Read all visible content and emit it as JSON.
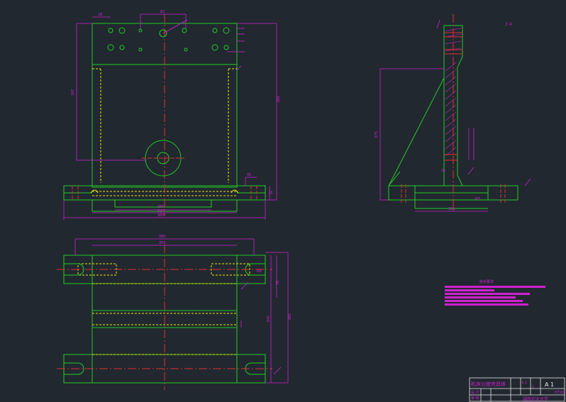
{
  "colors": {
    "background": "#212830",
    "outline": "#22cc22",
    "hidden": "#e8e800",
    "center": "#e03030",
    "dimension": "#d020d0",
    "bolt": "#e03030"
  },
  "front_view": {
    "dims": {
      "top_left": "26",
      "top_mid": "82",
      "overall_width": "380",
      "base_inner": "280",
      "base_mid": "320",
      "height_left": "347",
      "height_right": "388",
      "right_side": "45",
      "right_low": "36"
    }
  },
  "side_view": {
    "dims": {
      "height": "375",
      "base_width": "100",
      "fillet": "R5",
      "small": "2x"
    }
  },
  "plan_view": {
    "dims": {
      "overall_width": "380",
      "inner_width": "300",
      "h1": "78",
      "h2": "340",
      "h3": "380",
      "right_small": "R8"
    }
  },
  "top_right_note": "3 4",
  "notes_title": "技术要求",
  "title_block": {
    "title": "机床分度夹具体",
    "scale": "1:1",
    "sheet": "A 1",
    "material": "HT20",
    "school": "湖南农业大学",
    "row1": "设 计",
    "row2": "审 核",
    "row3": "批 准",
    "count": "1"
  }
}
